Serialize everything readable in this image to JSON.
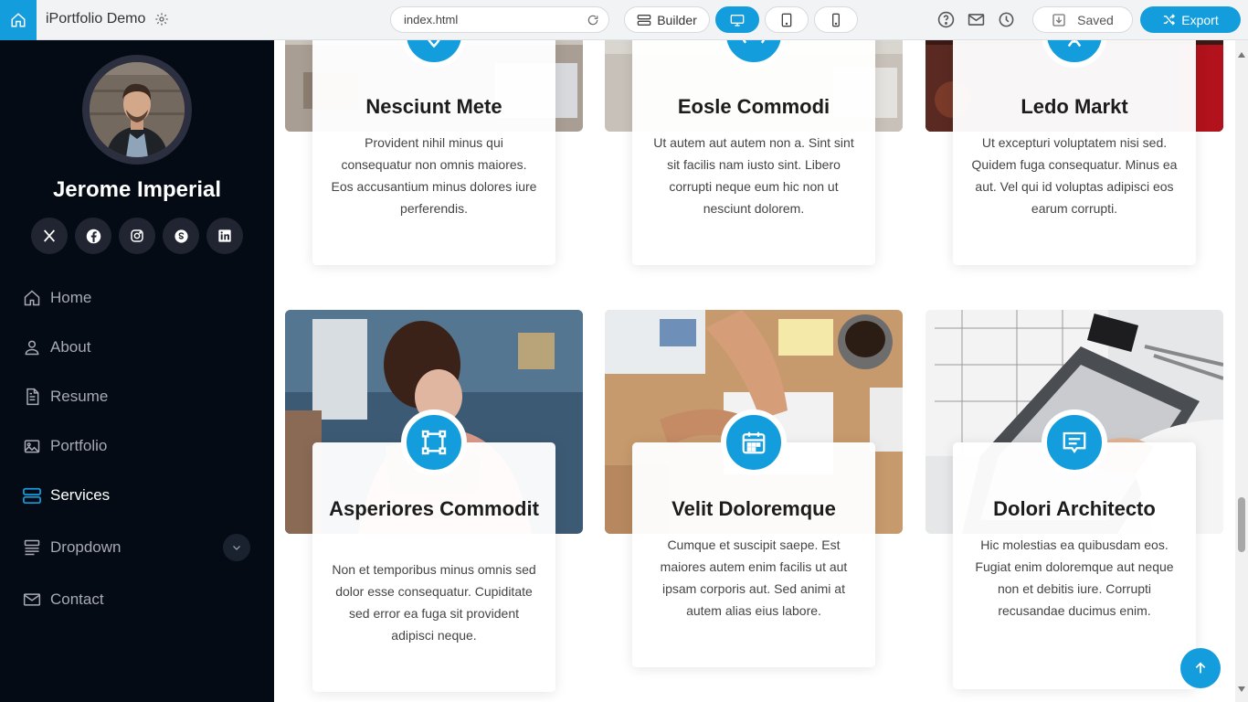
{
  "toolbar": {
    "app_title": "iPortfolio Demo",
    "url": "index.html",
    "builder_label": "Builder",
    "saved_label": "Saved",
    "export_label": "Export"
  },
  "sidebar": {
    "name": "Jerome Imperial",
    "nav": [
      {
        "label": "Home"
      },
      {
        "label": "About"
      },
      {
        "label": "Resume"
      },
      {
        "label": "Portfolio"
      },
      {
        "label": "Services"
      },
      {
        "label": "Dropdown"
      },
      {
        "label": "Contact"
      }
    ],
    "active_item": "Services"
  },
  "services": [
    {
      "title": "Nesciunt Mete",
      "description": "Provident nihil minus qui consequatur non omnis maiores. Eos accusantium minus dolores iure perferendis.",
      "icon": "map-pin-icon"
    },
    {
      "title": "Eosle Commodi",
      "description": "Ut autem aut autem non a. Sint sint sit facilis nam iusto sint. Libero corrupti neque eum hic non ut nesciunt dolorem.",
      "icon": "broadcast-icon"
    },
    {
      "title": "Ledo Markt",
      "description": "Ut excepturi voluptatem nisi sed. Quidem fuga consequatur. Minus ea aut. Vel qui id voluptas adipisci eos earum corrupti.",
      "icon": "easel-icon"
    },
    {
      "title": "Asperiores Commodit",
      "description": "Non et temporibus minus omnis sed dolor esse consequatur. Cupiditate sed error ea fuga sit provident adipisci neque.",
      "icon": "bounding-box-icon"
    },
    {
      "title": "Velit Doloremque",
      "description": "Cumque et suscipit saepe. Est maiores autem enim facilis ut aut ipsam corporis aut. Sed animi at autem alias eius labore.",
      "icon": "calendar-icon"
    },
    {
      "title": "Dolori Architecto",
      "description": "Hic molestias ea quibusdam eos. Fugiat enim doloremque aut neque non et debitis iure. Corrupti recusandae ducimus enim.",
      "icon": "chat-square-text-icon"
    }
  ],
  "colors": {
    "accent": "#149ddd",
    "sidebar_bg": "#040b14",
    "social_bg": "#212431"
  }
}
